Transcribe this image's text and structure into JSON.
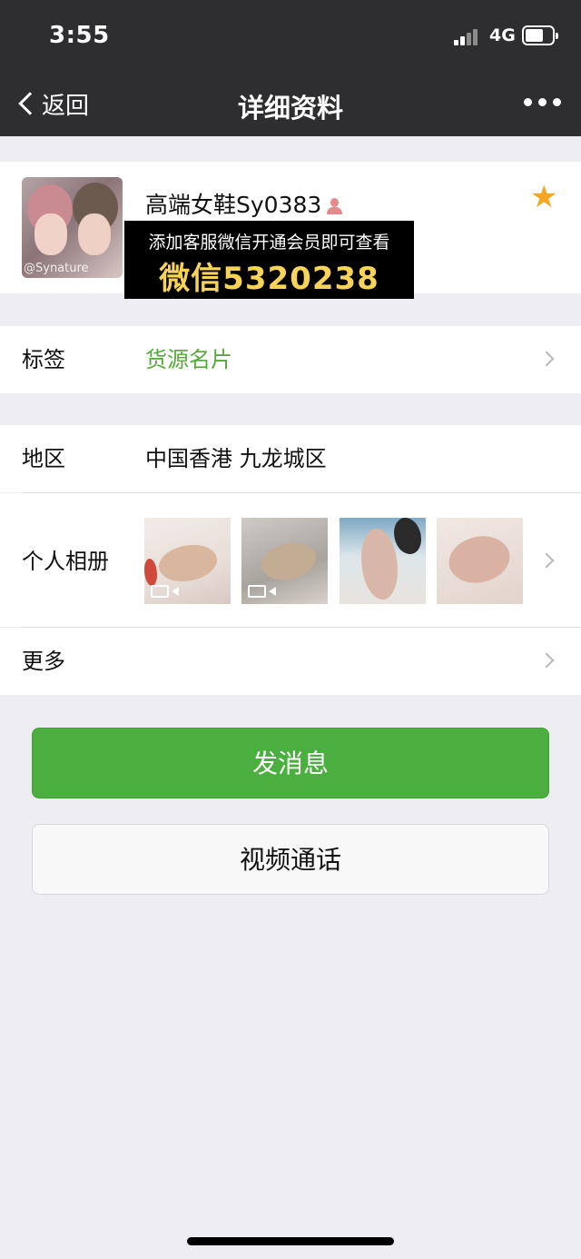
{
  "status_bar": {
    "time": "3:55",
    "network": "4G",
    "battery_level": 0.6
  },
  "nav": {
    "back_label": "返回",
    "title": "详细资料",
    "more_icon": "more-dots-icon"
  },
  "profile": {
    "name": "高端女鞋Sy0383",
    "avatar_watermark": "@Synature",
    "starred": true,
    "star_color": "#f5a623"
  },
  "banner": {
    "line1": "添加客服微信开通会员即可查看",
    "line2": "微信5320238"
  },
  "rows": {
    "tags": {
      "label": "标签",
      "value": "货源名片"
    },
    "region": {
      "label": "地区",
      "value": "中国香港 九龙城区"
    },
    "album": {
      "label": "个人相册"
    },
    "more": {
      "label": "更多"
    }
  },
  "buttons": {
    "send_message": "发消息",
    "video_call": "视频通话"
  },
  "colors": {
    "accent_green": "#4baf3f",
    "nav_bg": "#2e2e30",
    "banner_text": "#f7d35a"
  }
}
